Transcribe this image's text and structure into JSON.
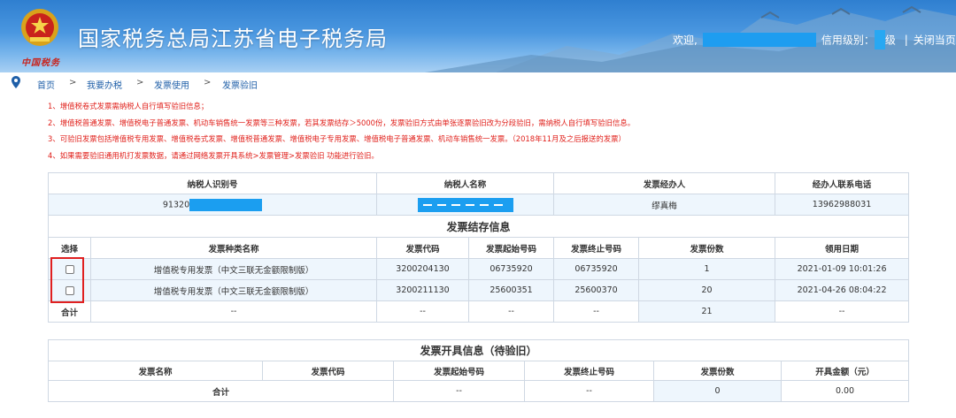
{
  "header": {
    "title": "国家税务总局江苏省电子税务局",
    "brand_sub": "中国税务",
    "welcome": "欢迎,",
    "credit_label": "信用级别：",
    "credit_suffix": "级",
    "separator": "|",
    "close_label": "关闭当页"
  },
  "breadcrumb": {
    "items": [
      "首页",
      "我要办税",
      "发票使用",
      "发票验旧"
    ],
    "separator": ">"
  },
  "notices": [
    "1、增值税卷式发票需纳税人自行填写验旧信息；",
    "2、增值税普通发票、增值税电子普通发票、机动车销售统一发票等三种发票，若其发票结存＞5000份，发票验旧方式由单张逐票验旧改为分段验旧，需纳税人自行填写验旧信息。",
    "3、可验旧发票包括增值税专用发票、增值税卷式发票、增值税普通发票、增值税电子专用发票、增值税电子普通发票、机动车销售统一发票。（2018年11月及之后报送的发票）",
    "4、如果需要验旧通用机打发票数据，请通过网络发票开具系统>发票管理>发票验旧 功能进行验旧。"
  ],
  "taxpayer": {
    "headers": [
      "纳税人识别号",
      "纳税人名称",
      "发票经办人",
      "经办人联系电话"
    ],
    "id_prefix": "91320",
    "handler": "缪真梅",
    "phone": "13962988031"
  },
  "inventory": {
    "title": "发票结存信息",
    "headers": [
      "选择",
      "发票种类名称",
      "发票代码",
      "发票起始号码",
      "发票终止号码",
      "发票份数",
      "领用日期"
    ],
    "rows": [
      {
        "name": "增值税专用发票（中文三联无金额限制版）",
        "code": "3200204130",
        "start": "06735920",
        "end": "06735920",
        "count": "1",
        "date": "2021-01-09 10:01:26"
      },
      {
        "name": "增值税专用发票（中文三联无金额限制版）",
        "code": "3200211130",
        "start": "25600351",
        "end": "25600370",
        "count": "20",
        "date": "2021-04-26 08:04:22"
      }
    ],
    "total": {
      "label": "合计",
      "name": "--",
      "code": "--",
      "start": "--",
      "end": "--",
      "count": "21",
      "date": "--"
    }
  },
  "issued": {
    "title": "发票开具信息（待验旧）",
    "headers": [
      "发票名称",
      "发票代码",
      "发票起始号码",
      "发票终止号码",
      "发票份数",
      "开具金额（元）"
    ],
    "total": {
      "label": "合计",
      "start": "--",
      "end": "--",
      "count": "0",
      "amount": "0.00"
    }
  },
  "colors": {
    "header_top": "#2f7fd0",
    "notice_red": "#e0201b",
    "link_blue": "#1f5fa8",
    "highlight_box": "#e02020"
  }
}
